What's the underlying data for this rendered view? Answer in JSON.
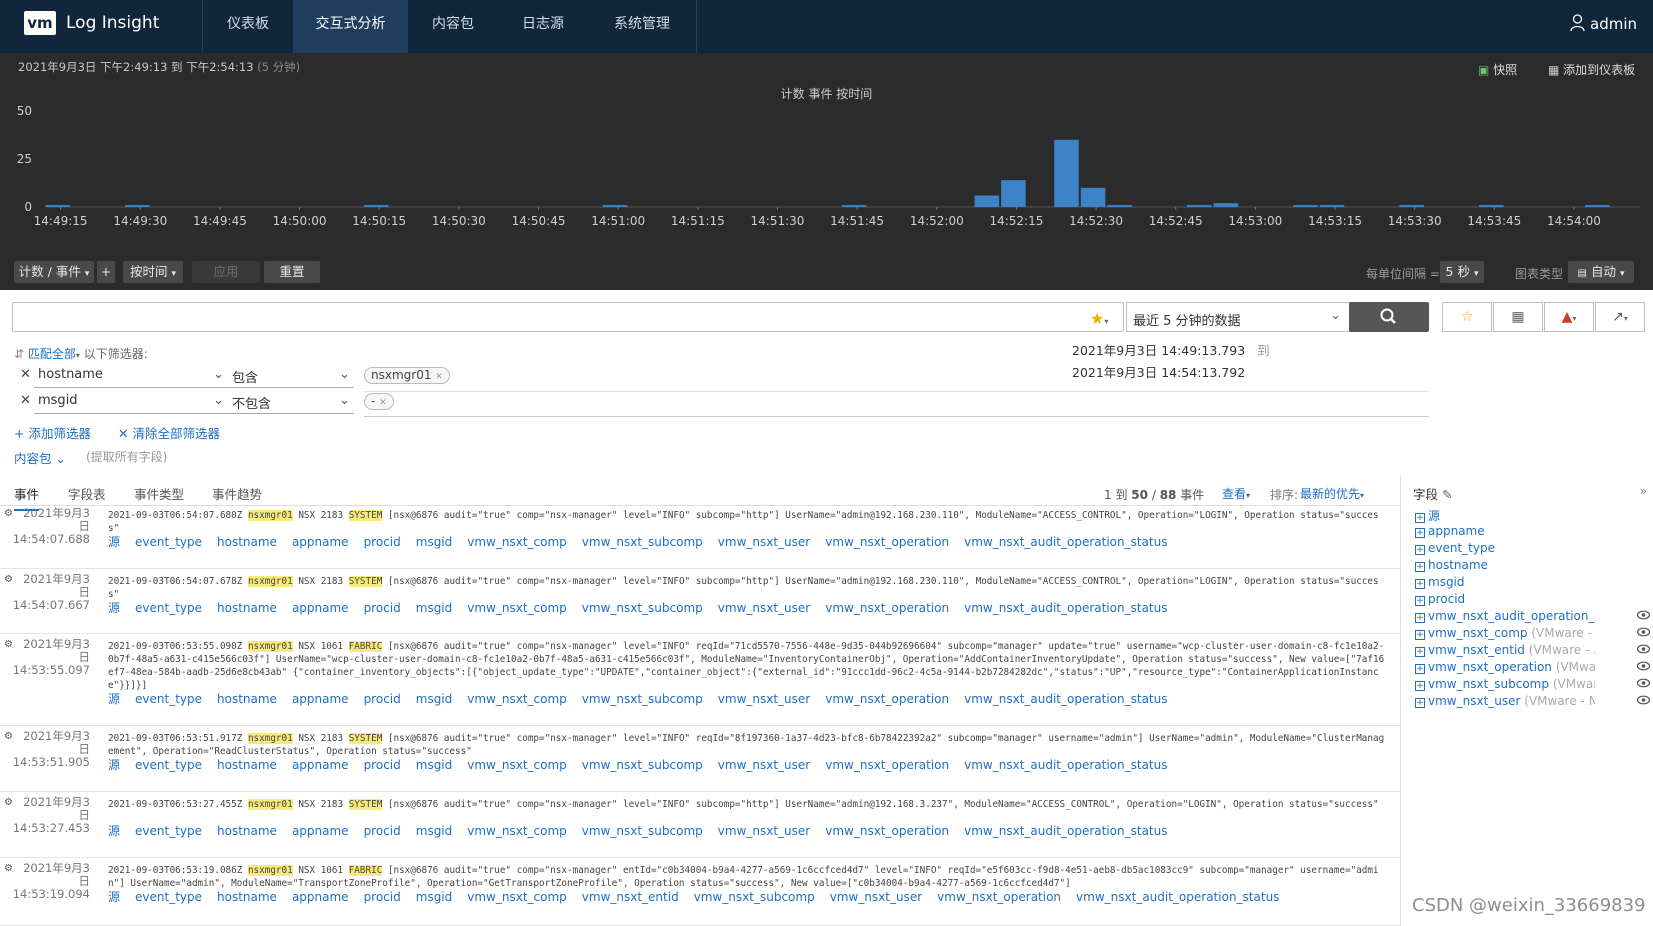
{
  "nav": {
    "logo": "vm",
    "app_title": "Log Insight",
    "tabs": [
      "仪表板",
      "交互式分析",
      "内容包",
      "日志源",
      "系统管理"
    ],
    "active_tab": "交互式分析",
    "user": "admin"
  },
  "chart_panel": {
    "time_range": "2021年9月3日 下午2:49:13 到 下午2:54:13",
    "duration": "(5 分钟)",
    "snapshot": "快照",
    "add_to_dashboard": "添加到仪表板"
  },
  "chart_data": {
    "type": "bar",
    "title": "计数 事件 按时间",
    "y_ticks": [
      "50",
      "25",
      "0"
    ],
    "ylim": [
      0,
      50
    ],
    "x_tick_labels": [
      "14:49:15",
      "14:49:30",
      "14:49:45",
      "14:50:00",
      "14:50:15",
      "14:50:30",
      "14:50:45",
      "14:51:00",
      "14:51:15",
      "14:51:30",
      "14:51:45",
      "14:52:00",
      "14:52:15",
      "14:52:30",
      "14:52:45",
      "14:53:00",
      "14:53:15",
      "14:53:30",
      "14:53:45",
      "14:54:00"
    ],
    "bin_seconds": 5,
    "bars": [
      {
        "x": "14:49:15",
        "value": 1
      },
      {
        "x": "14:49:30",
        "value": 1
      },
      {
        "x": "14:50:15",
        "value": 1
      },
      {
        "x": "14:51:00",
        "value": 1
      },
      {
        "x": "14:51:45",
        "value": 1
      },
      {
        "x": "14:52:10",
        "value": 6
      },
      {
        "x": "14:52:15",
        "value": 14
      },
      {
        "x": "14:52:25",
        "value": 35
      },
      {
        "x": "14:52:30",
        "value": 10
      },
      {
        "x": "14:52:35",
        "value": 1
      },
      {
        "x": "14:52:50",
        "value": 1
      },
      {
        "x": "14:52:55",
        "value": 2
      },
      {
        "x": "14:53:10",
        "value": 1
      },
      {
        "x": "14:53:15",
        "value": 1
      },
      {
        "x": "14:53:30",
        "value": 1
      },
      {
        "x": "14:53:45",
        "value": 1
      },
      {
        "x": "14:54:05",
        "value": 1
      }
    ],
    "bar_color": "#3d83c6",
    "grid": false
  },
  "controls": {
    "count_events": "计数 / 事件",
    "plus": "+",
    "by_time": "按时间",
    "apply": "应用",
    "reset": "重置",
    "bin_label": "每单位间隔 =",
    "bin_value": "5 秒",
    "chart_type_label": "图表类型",
    "chart_type_value": "自动"
  },
  "search": {
    "query": "",
    "range": "最近 5 分钟的数据"
  },
  "filters": {
    "match_all": "匹配全部",
    "following": "以下筛选器:",
    "rows": [
      {
        "field": "hostname",
        "op": "包含",
        "value": "nsxmgr01"
      },
      {
        "field": "msgid",
        "op": "不包含",
        "value": "-"
      }
    ],
    "start_date": "2021年9月3日  14:49:13.793",
    "to": "到",
    "end_date": "2021年9月3日  14:54:13.792",
    "add_filter": "添加筛选器",
    "clear_filters": "清除全部筛选器",
    "content_pack": "内容包",
    "extract_hint": "(提取所有字段)"
  },
  "tabs": [
    "事件",
    "字段表",
    "事件类型",
    "事件趋势"
  ],
  "results": {
    "range": "1 到",
    "shown": "50",
    "slash": "/",
    "total": "88",
    "events_word": "事件",
    "view": "查看",
    "sort_label": "排序:",
    "sort_value": "最新的优先"
  },
  "events": [
    {
      "date": "2021年9月3日",
      "time": "14:54:07.688",
      "pre": "2021-09-03T06:54:07.680Z ",
      "host": "nsxmgr01",
      "mid": " NSX 2183 ",
      "tag": "SYSTEM",
      "rest": " [nsx@6876 audit=\"true\" comp=\"nsx-manager\" level=\"INFO\" subcomp=\"http\"] UserName=\"admin@192.168.230.110\", ModuleName=\"ACCESS_CONTROL\", Operation=\"LOGIN\", Operation status=\"success\"",
      "fields": [
        "源",
        "event_type",
        "hostname",
        "appname",
        "procid",
        "msgid",
        "vmw_nsxt_comp",
        "vmw_nsxt_subcomp",
        "vmw_nsxt_user",
        "vmw_nsxt_operation",
        "vmw_nsxt_audit_operation_status"
      ]
    },
    {
      "date": "2021年9月3日",
      "time": "14:54:07.667",
      "pre": "2021-09-03T06:54:07.678Z ",
      "host": "nsxmgr01",
      "mid": " NSX 2183 ",
      "tag": "SYSTEM",
      "rest": " [nsx@6876 audit=\"true\" comp=\"nsx-manager\" level=\"INFO\" subcomp=\"http\"] UserName=\"admin@192.168.230.110\", ModuleName=\"ACCESS_CONTROL\", Operation=\"LOGIN\", Operation status=\"success\"",
      "fields": [
        "源",
        "event_type",
        "hostname",
        "appname",
        "procid",
        "msgid",
        "vmw_nsxt_comp",
        "vmw_nsxt_subcomp",
        "vmw_nsxt_user",
        "vmw_nsxt_operation",
        "vmw_nsxt_audit_operation_status"
      ]
    },
    {
      "date": "2021年9月3日",
      "time": "14:53:55.097",
      "pre": "2021-09-03T06:53:55.090Z ",
      "host": "nsxmgr01",
      "mid": " NSX 1061 ",
      "tag": "FABRIC",
      "rest": " [nsx@6876 audit=\"true\" comp=\"nsx-manager\" level=\"INFO\" reqId=\"71cd5570-7556-448e-9d35-044b92696604\" subcomp=\"manager\" update=\"true\" username=\"wcp-cluster-user-domain-c8-fc1e10a2-0b7f-48a5-a631-c415e566c03f\"] UserName=\"wcp-cluster-user-domain-c8-fc1e10a2-0b7f-48a5-a631-c415e566c03f\", ModuleName=\"InventoryContainerObj\", Operation=\"AddContainerInventoryUpdate\", Operation status=\"success\", New value=[\"7af16ef7-48ea-584b-aadb-25d6e8cb43ab\" {\"container_inventory_objects\":[{\"object_update_type\":\"UPDATE\",\"container_object\":{\"external_id\":\"91ccc1dd-96c2-4c5a-9144-b2b7284282dc\",\"status\":\"UP\",\"resource_type\":\"ContainerApplicationInstance\"}}]}]",
      "fields": [
        "源",
        "event_type",
        "hostname",
        "appname",
        "procid",
        "msgid",
        "vmw_nsxt_comp",
        "vmw_nsxt_subcomp",
        "vmw_nsxt_user",
        "vmw_nsxt_operation",
        "vmw_nsxt_audit_operation_status"
      ]
    },
    {
      "date": "2021年9月3日",
      "time": "14:53:51.905",
      "pre": "2021-09-03T06:53:51.917Z ",
      "host": "nsxmgr01",
      "mid": " NSX 2183 ",
      "tag": "SYSTEM",
      "rest": " [nsx@6876 audit=\"true\" comp=\"nsx-manager\" level=\"INFO\" reqId=\"8f197360-1a37-4d23-bfc8-6b78422392a2\" subcomp=\"manager\" username=\"admin\"] UserName=\"admin\", ModuleName=\"ClusterManagement\", Operation=\"ReadClusterStatus\", Operation status=\"success\"",
      "fields": [
        "源",
        "event_type",
        "hostname",
        "appname",
        "procid",
        "msgid",
        "vmw_nsxt_comp",
        "vmw_nsxt_subcomp",
        "vmw_nsxt_user",
        "vmw_nsxt_operation",
        "vmw_nsxt_audit_operation_status"
      ]
    },
    {
      "date": "2021年9月3日",
      "time": "14:53:27.453",
      "pre": "2021-09-03T06:53:27.455Z ",
      "host": "nsxmgr01",
      "mid": " NSX 2183 ",
      "tag": "SYSTEM",
      "rest": " [nsx@6876 audit=\"true\" comp=\"nsx-manager\" level=\"INFO\" subcomp=\"http\"] UserName=\"admin@192.168.3.237\", ModuleName=\"ACCESS_CONTROL\", Operation=\"LOGIN\", Operation status=\"success\"",
      "fields": [
        "源",
        "event_type",
        "hostname",
        "appname",
        "procid",
        "msgid",
        "vmw_nsxt_comp",
        "vmw_nsxt_subcomp",
        "vmw_nsxt_user",
        "vmw_nsxt_operation",
        "vmw_nsxt_audit_operation_status"
      ]
    },
    {
      "date": "2021年9月3日",
      "time": "14:53:19.094",
      "pre": "2021-09-03T06:53:19.086Z ",
      "host": "nsxmgr01",
      "mid": " NSX 1061 ",
      "tag": "FABRIC",
      "rest": " [nsx@6876 audit=\"true\" comp=\"nsx-manager\" entId=\"c0b34004-b9a4-4277-a569-1c6ccfced4d7\" level=\"INFO\" reqId=\"e5f603cc-f9d8-4e51-aeb8-db5ac1083cc9\" subcomp=\"manager\" username=\"admin\"] UserName=\"admin\", ModuleName=\"TransportZoneProfile\", Operation=\"GetTransportZoneProfile\", Operation status=\"success\", New value=[\"c0b34004-b9a4-4277-a569-1c6ccfced4d7\"]",
      "fields": [
        "源",
        "event_type",
        "hostname",
        "appname",
        "procid",
        "msgid",
        "vmw_nsxt_comp",
        "vmw_nsxt_entid",
        "vmw_nsxt_subcomp",
        "vmw_nsxt_user",
        "vmw_nsxt_operation",
        "vmw_nsxt_audit_operation_status"
      ]
    }
  ],
  "sidebar": {
    "title": "字段",
    "fields": [
      {
        "name": "源",
        "ext": "",
        "eye": false
      },
      {
        "name": "appname",
        "ext": "",
        "eye": false
      },
      {
        "name": "event_type",
        "ext": "",
        "eye": false
      },
      {
        "name": "hostname",
        "ext": "",
        "eye": false
      },
      {
        "name": "msgid",
        "ext": "",
        "eye": false
      },
      {
        "name": "procid",
        "ext": "",
        "eye": false
      },
      {
        "name": "vmw_nsxt_audit_operation_s...",
        "ext": "",
        "eye": true
      },
      {
        "name": "vmw_nsxt_comp",
        "ext": " (VMware - ...",
        "eye": true
      },
      {
        "name": "vmw_nsxt_entid",
        "ext": " (VMware - ...",
        "eye": true
      },
      {
        "name": "vmw_nsxt_operation",
        "ext": " (VMwar...",
        "eye": true
      },
      {
        "name": "vmw_nsxt_subcomp",
        "ext": " (VMwar...",
        "eye": true
      },
      {
        "name": "vmw_nsxt_user",
        "ext": " (VMware - N...",
        "eye": true
      }
    ]
  },
  "watermark": "CSDN @weixin_33669839"
}
